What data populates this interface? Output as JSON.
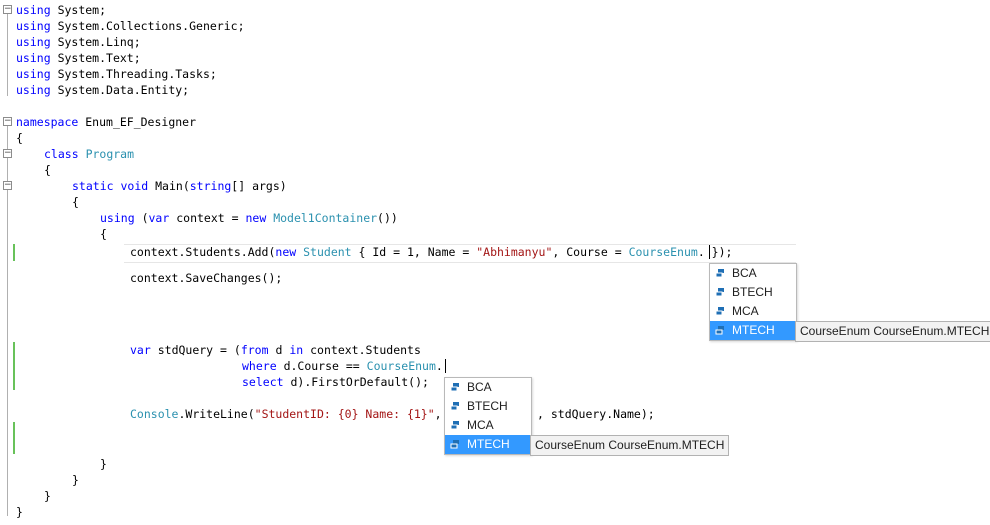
{
  "code": {
    "using_kw": "using",
    "usings": [
      "System;",
      "System.Collections.Generic;",
      "System.Linq;",
      "System.Text;",
      "System.Threading.Tasks;",
      "System.Data.Entity;"
    ],
    "namespace_kw": "namespace",
    "namespace_name": "Enum_EF_Designer",
    "class_kw": "class",
    "class_name": "Program",
    "static_kw": "static",
    "void_kw": "void",
    "main_sig": "Main(",
    "string_kw": "string",
    "main_args": "[] args)",
    "using_open": "(",
    "var_kw": "var",
    "context_assign": "context = ",
    "new_kw": "new",
    "container_type": "Model1Container",
    "container_close": "())",
    "add_prefix": "context.Students.Add(",
    "student_type": "Student",
    "add_mid": " { Id = 1, Name = ",
    "name_str": "\"Abhimanyu\"",
    "course_part": ", Course = ",
    "enum_type": "CourseEnum",
    "dot": ".",
    "add_suffix": " });",
    "save_changes": "context.SaveChanges();",
    "stdquery_part": "stdQuery = (",
    "from_kw": "from",
    "d_part": "d",
    "in_kw": "in",
    "students": "context.Students",
    "where_kw": "where",
    "where_part": "d.Course == ",
    "select_kw": "select",
    "select_part": "d).FirstOrDefault();",
    "console_type": "Console",
    "writeline": ".WriteLine(",
    "fmt_str": "\"StudentID: {0} Name: {1}\"",
    "comma": ",",
    "writeline_tail": ", stdQuery.Name);",
    "open_brace": "{",
    "close_brace": "}"
  },
  "intellisense_top": {
    "items": [
      "BCA",
      "BTECH",
      "MCA",
      "MTECH"
    ],
    "selected": "MTECH",
    "tooltip": "CourseEnum CourseEnum.MTECH",
    "icon": "enum-member-icon"
  },
  "intellisense_bottom": {
    "items": [
      "BCA",
      "BTECH",
      "MCA",
      "MTECH"
    ],
    "selected": "MTECH",
    "tooltip": "CourseEnum CourseEnum.MTECH",
    "icon": "enum-member-icon"
  },
  "colors": {
    "keyword": "#0000ff",
    "type": "#2b91af",
    "string": "#a31515",
    "selection": "#3399ff",
    "change_bar": "#68c25a"
  }
}
